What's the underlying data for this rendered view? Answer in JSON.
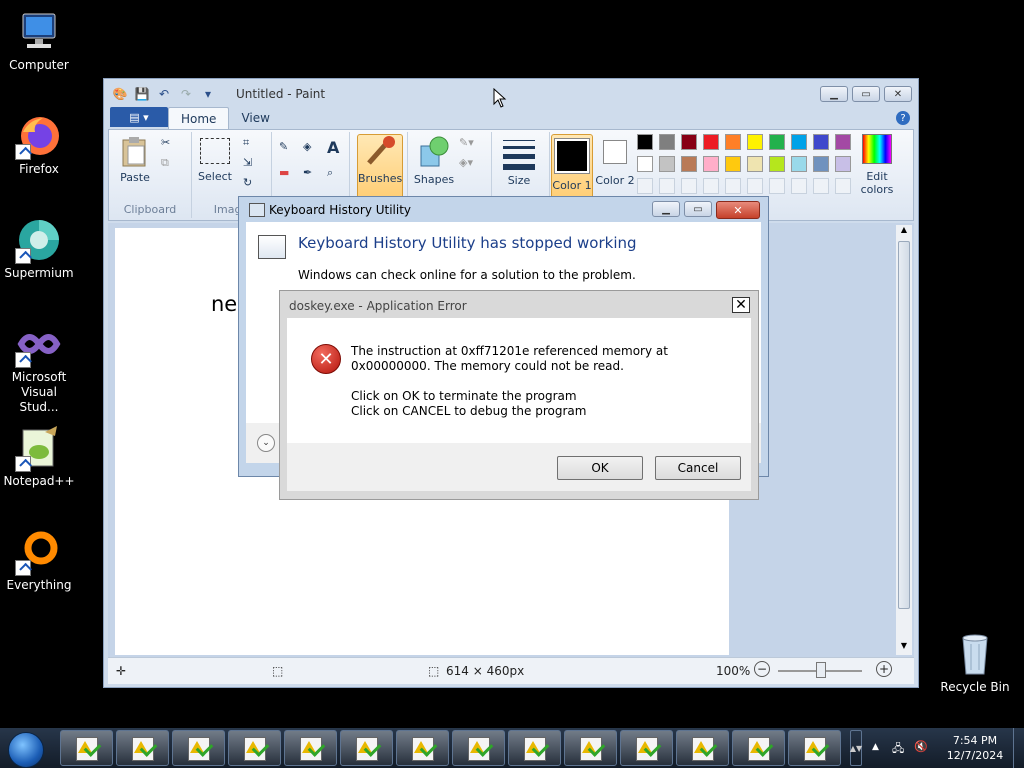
{
  "desktop": {
    "icons": [
      {
        "label": "Computer"
      },
      {
        "label": "Firefox"
      },
      {
        "label": "Supermium"
      },
      {
        "label": "Microsoft Visual Stud..."
      },
      {
        "label": "Notepad++"
      },
      {
        "label": "Everything"
      }
    ],
    "recycle_bin": "Recycle Bin"
  },
  "paint": {
    "title": "Untitled - Paint",
    "tabs": [
      "Home",
      "View"
    ],
    "groups": {
      "clipboard": {
        "label": "Clipboard",
        "paste": "Paste"
      },
      "image": {
        "label": "Image",
        "select": "Select"
      },
      "brushes": "Brushes",
      "shapes": "Shapes",
      "size": "Size",
      "color1": "Color 1",
      "color2": "Color 2",
      "edit_colors": "Edit colors"
    },
    "palette_row1": [
      "#000000",
      "#7f7f7f",
      "#880015",
      "#ed1c24",
      "#ff7f27",
      "#fff200",
      "#22b14c",
      "#00a2e8",
      "#3f48cc",
      "#a349a4"
    ],
    "palette_row2": [
      "#ffffff",
      "#c3c3c3",
      "#b97a57",
      "#ffaec9",
      "#ffc90e",
      "#efe4b0",
      "#b5e61d",
      "#99d9ea",
      "#7092be",
      "#c8bfe7"
    ],
    "canvas_text": "ne",
    "status": {
      "size": "614 × 460px",
      "zoom": "100%"
    }
  },
  "khu_dialog": {
    "title": "Keyboard History Utility",
    "heading": "Keyboard History Utility has stopped working",
    "subtext": "Windows can check online for a solution to the problem."
  },
  "error_dialog": {
    "title": "doskey.exe - Application Error",
    "line1": "The instruction at 0xff71201e referenced memory at 0x00000000. The memory could not be read.",
    "line2": "Click on OK to terminate the program",
    "line3": "Click on CANCEL to debug the program",
    "ok": "OK",
    "cancel": "Cancel"
  },
  "taskbar": {
    "item_count": 14,
    "time": "7:54 PM",
    "date": "12/7/2024"
  }
}
